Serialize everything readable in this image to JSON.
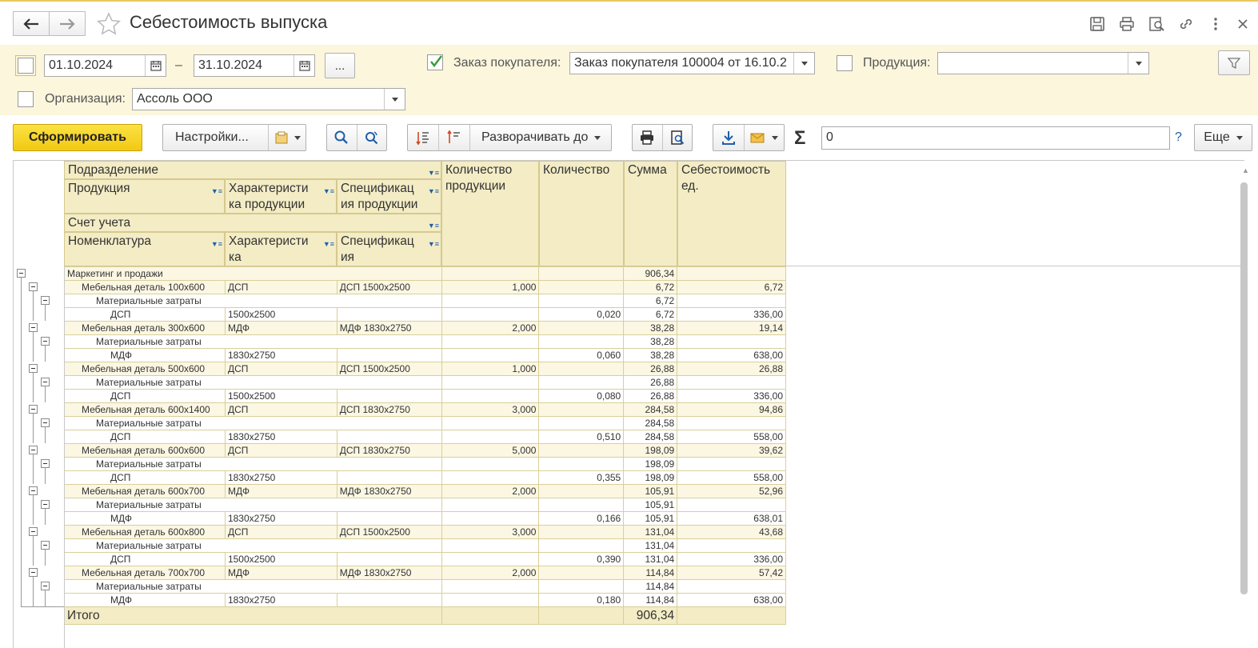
{
  "window": {
    "title": "Себестоимость выпуска"
  },
  "filters": {
    "date_from": "01.10.2024",
    "date_sep": "–",
    "date_to": "31.10.2024",
    "more_btn": "...",
    "order_label": "Заказ покупателя:",
    "order_value": "Заказ покупателя 100004 от 16.10.2",
    "product_label": "Продукция:",
    "product_value": "",
    "org_label": "Организация:",
    "org_value": "Ассоль ООО"
  },
  "toolbar": {
    "generate": "Сформировать",
    "settings": "Настройки...",
    "expand_to": "Разворачивать до",
    "sum_value": "0",
    "help": "?",
    "more": "Еще"
  },
  "report": {
    "headers": {
      "division": "Подразделение",
      "product": "Продукция",
      "product_char": "Характеристи ка продукции",
      "product_spec": "Спецификац ия продукции",
      "account": "Счет учета",
      "nomenclature": "Номенклатура",
      "char": "Характеристи ка",
      "spec": "Спецификац ия",
      "qty_product": "Количество продукции",
      "qty": "Количество",
      "sum": "Сумма",
      "unit_cost": "Себестоимость ед."
    },
    "rows": [
      {
        "level": 0,
        "name": "Маркетинг и продажи",
        "char": "",
        "spec": "",
        "qty_product": "",
        "qty": "",
        "sum": "906,34",
        "unit_cost": ""
      },
      {
        "level": 1,
        "name": "Мебельная деталь 100x600",
        "char": "ДСП",
        "spec": "ДСП 1500x2500",
        "qty_product": "1,000",
        "qty": "",
        "sum": "6,72",
        "unit_cost": "6,72"
      },
      {
        "level": 2,
        "name": "Материальные затраты",
        "char": "",
        "spec": "",
        "qty_product": "",
        "qty": "",
        "sum": "6,72",
        "unit_cost": ""
      },
      {
        "level": 3,
        "name": "ДСП",
        "char": "1500x2500",
        "spec": "",
        "qty_product": "",
        "qty": "0,020",
        "sum": "6,72",
        "unit_cost": "336,00"
      },
      {
        "level": 1,
        "name": "Мебельная деталь 300x600",
        "char": "МДФ",
        "spec": "МДФ 1830x2750",
        "qty_product": "2,000",
        "qty": "",
        "sum": "38,28",
        "unit_cost": "19,14"
      },
      {
        "level": 2,
        "name": "Материальные затраты",
        "char": "",
        "spec": "",
        "qty_product": "",
        "qty": "",
        "sum": "38,28",
        "unit_cost": ""
      },
      {
        "level": 3,
        "name": "МДФ",
        "char": "1830x2750",
        "spec": "",
        "qty_product": "",
        "qty": "0,060",
        "sum": "38,28",
        "unit_cost": "638,00"
      },
      {
        "level": 1,
        "name": "Мебельная деталь 500x600",
        "char": "ДСП",
        "spec": "ДСП 1500x2500",
        "qty_product": "1,000",
        "qty": "",
        "sum": "26,88",
        "unit_cost": "26,88"
      },
      {
        "level": 2,
        "name": "Материальные затраты",
        "char": "",
        "spec": "",
        "qty_product": "",
        "qty": "",
        "sum": "26,88",
        "unit_cost": ""
      },
      {
        "level": 3,
        "name": "ДСП",
        "char": "1500x2500",
        "spec": "",
        "qty_product": "",
        "qty": "0,080",
        "sum": "26,88",
        "unit_cost": "336,00"
      },
      {
        "level": 1,
        "name": "Мебельная деталь 600x1400",
        "char": "ДСП",
        "spec": "ДСП 1830x2750",
        "qty_product": "3,000",
        "qty": "",
        "sum": "284,58",
        "unit_cost": "94,86"
      },
      {
        "level": 2,
        "name": "Материальные затраты",
        "char": "",
        "spec": "",
        "qty_product": "",
        "qty": "",
        "sum": "284,58",
        "unit_cost": ""
      },
      {
        "level": 3,
        "name": "ДСП",
        "char": "1830x2750",
        "spec": "",
        "qty_product": "",
        "qty": "0,510",
        "sum": "284,58",
        "unit_cost": "558,00"
      },
      {
        "level": 1,
        "name": "Мебельная деталь 600x600",
        "char": "ДСП",
        "spec": "ДСП 1830x2750",
        "qty_product": "5,000",
        "qty": "",
        "sum": "198,09",
        "unit_cost": "39,62"
      },
      {
        "level": 2,
        "name": "Материальные затраты",
        "char": "",
        "spec": "",
        "qty_product": "",
        "qty": "",
        "sum": "198,09",
        "unit_cost": ""
      },
      {
        "level": 3,
        "name": "ДСП",
        "char": "1830x2750",
        "spec": "",
        "qty_product": "",
        "qty": "0,355",
        "sum": "198,09",
        "unit_cost": "558,00"
      },
      {
        "level": 1,
        "name": "Мебельная деталь 600x700",
        "char": "МДФ",
        "spec": "МДФ 1830x2750",
        "qty_product": "2,000",
        "qty": "",
        "sum": "105,91",
        "unit_cost": "52,96"
      },
      {
        "level": 2,
        "name": "Материальные затраты",
        "char": "",
        "spec": "",
        "qty_product": "",
        "qty": "",
        "sum": "105,91",
        "unit_cost": ""
      },
      {
        "level": 3,
        "name": "МДФ",
        "char": "1830x2750",
        "spec": "",
        "qty_product": "",
        "qty": "0,166",
        "sum": "105,91",
        "unit_cost": "638,01"
      },
      {
        "level": 1,
        "name": "Мебельная деталь 600x800",
        "char": "ДСП",
        "spec": "ДСП 1500x2500",
        "qty_product": "3,000",
        "qty": "",
        "sum": "131,04",
        "unit_cost": "43,68"
      },
      {
        "level": 2,
        "name": "Материальные затраты",
        "char": "",
        "spec": "",
        "qty_product": "",
        "qty": "",
        "sum": "131,04",
        "unit_cost": ""
      },
      {
        "level": 3,
        "name": "ДСП",
        "char": "1500x2500",
        "spec": "",
        "qty_product": "",
        "qty": "0,390",
        "sum": "131,04",
        "unit_cost": "336,00"
      },
      {
        "level": 1,
        "name": "Мебельная деталь 700x700",
        "char": "МДФ",
        "spec": "МДФ 1830x2750",
        "qty_product": "2,000",
        "qty": "",
        "sum": "114,84",
        "unit_cost": "57,42"
      },
      {
        "level": 2,
        "name": "Материальные затраты",
        "char": "",
        "spec": "",
        "qty_product": "",
        "qty": "",
        "sum": "114,84",
        "unit_cost": ""
      },
      {
        "level": 3,
        "name": "МДФ",
        "char": "1830x2750",
        "spec": "",
        "qty_product": "",
        "qty": "0,180",
        "sum": "114,84",
        "unit_cost": "638,00"
      }
    ],
    "total_label": "Итого",
    "total_sum": "906,34"
  },
  "colors": {
    "accent_yellow": "#f5d020",
    "filter_bg": "#fbf6dc",
    "header_bg": "#f3ecc5",
    "check_green": "#3a9a3a",
    "icon_blue": "#1f5fa8"
  }
}
